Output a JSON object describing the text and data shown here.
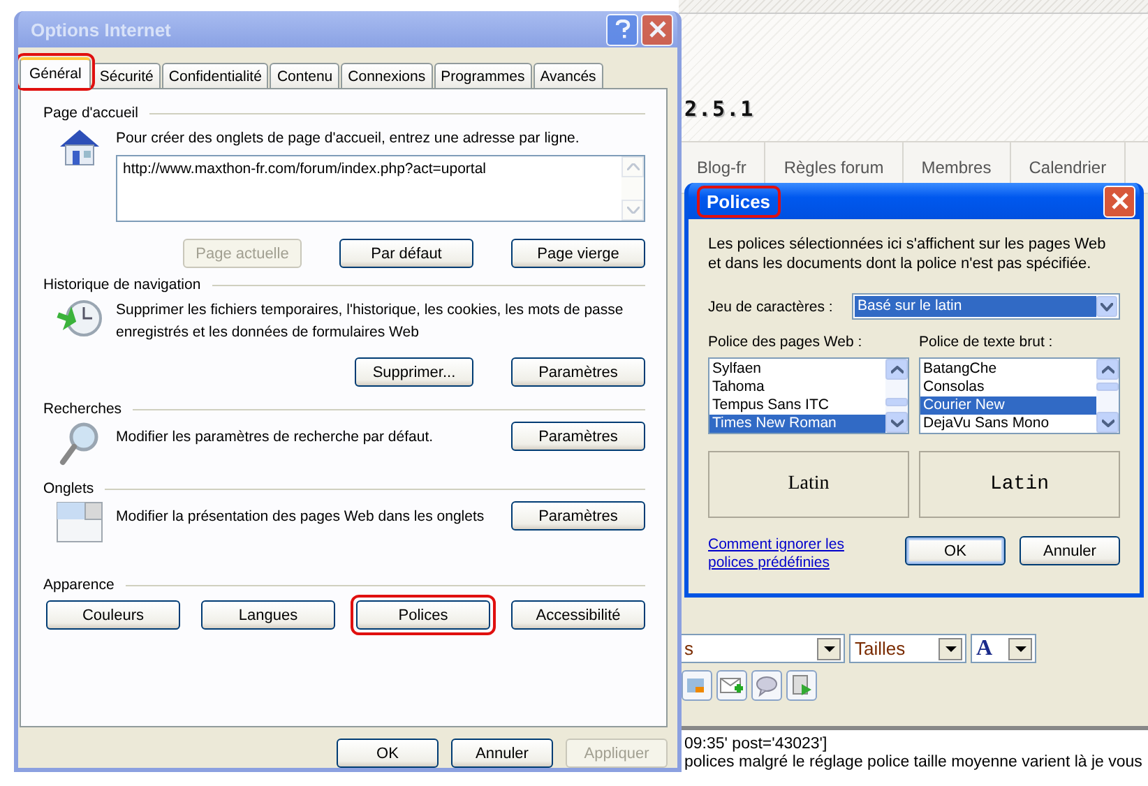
{
  "background_page": {
    "logo_text": "2.5.1",
    "nav": [
      "Blog-fr",
      "Règles forum",
      "Membres",
      "Calendrier"
    ],
    "toolbar": {
      "font_select": "s",
      "size_select": "Tailles",
      "color_button": "A"
    },
    "post_lines": [
      "09:35' post='43023']",
      "polices malgré le réglage police taille moyenne varient là je vous"
    ]
  },
  "options_dialog": {
    "title": "Options Internet",
    "active": false,
    "tabs": [
      {
        "label": "Général",
        "selected": true,
        "highlighted": true
      },
      {
        "label": "Sécurité",
        "selected": false,
        "highlighted": false
      },
      {
        "label": "Confidentialité",
        "selected": false,
        "highlighted": false
      },
      {
        "label": "Contenu",
        "selected": false,
        "highlighted": false
      },
      {
        "label": "Connexions",
        "selected": false,
        "highlighted": false
      },
      {
        "label": "Programmes",
        "selected": false,
        "highlighted": false
      },
      {
        "label": "Avancés",
        "selected": false,
        "highlighted": false
      }
    ],
    "sections": [
      {
        "kind": "homepage",
        "heading": "Page d'accueil",
        "description": "Pour créer des onglets de page d'accueil, entrez une adresse par ligne.",
        "address": "http://www.maxthon-fr.com/forum/index.php?act=uportal",
        "buttons": [
          {
            "label": "Page actuelle",
            "disabled": true,
            "highlighted": false
          },
          {
            "label": "Par défaut",
            "disabled": false,
            "highlighted": false
          },
          {
            "label": "Page vierge",
            "disabled": false,
            "highlighted": false
          }
        ]
      },
      {
        "kind": "history",
        "heading": "Historique de navigation",
        "description": "Supprimer les fichiers temporaires, l'historique, les cookies, les mots de passe enregistrés et les données de formulaires Web",
        "buttons": [
          {
            "label": "Supprimer...",
            "disabled": false,
            "highlighted": false
          },
          {
            "label": "Paramètres",
            "disabled": false,
            "highlighted": false
          }
        ]
      },
      {
        "kind": "search",
        "heading": "Recherches",
        "description": "Modifier les paramètres de recherche par défaut.",
        "buttons": [
          {
            "label": "Paramètres",
            "disabled": false,
            "highlighted": false
          }
        ]
      },
      {
        "kind": "tabs",
        "heading": "Onglets",
        "description": "Modifier la présentation des pages Web dans les onglets",
        "buttons": [
          {
            "label": "Paramètres",
            "disabled": false,
            "highlighted": false
          }
        ]
      },
      {
        "kind": "appearance",
        "heading": "Apparence",
        "buttons": [
          {
            "label": "Couleurs",
            "disabled": false,
            "highlighted": false
          },
          {
            "label": "Langues",
            "disabled": false,
            "highlighted": false
          },
          {
            "label": "Polices",
            "disabled": false,
            "highlighted": true
          },
          {
            "label": "Accessibilité",
            "disabled": false,
            "highlighted": false
          }
        ]
      }
    ],
    "footer_buttons": [
      {
        "label": "OK",
        "disabled": false
      },
      {
        "label": "Annuler",
        "disabled": false
      },
      {
        "label": "Appliquer",
        "disabled": true
      }
    ]
  },
  "fonts_dialog": {
    "title": "Polices",
    "active": true,
    "title_highlighted": true,
    "description": "Les polices sélectionnées ici s'affichent sur les pages Web et dans les documents dont la police n'est pas spécifiée.",
    "charset_label": "Jeu de caractères :",
    "charset_value": "Basé sur le latin",
    "lists": [
      {
        "label": "Police des pages Web :",
        "preview": "Latin",
        "kind": "proportional",
        "items": [
          {
            "name": "Sylfaen",
            "selected": false
          },
          {
            "name": "Tahoma",
            "selected": false
          },
          {
            "name": "Tempus Sans ITC",
            "selected": false
          },
          {
            "name": "Times New Roman",
            "selected": true
          }
        ]
      },
      {
        "label": "Police de texte brut :",
        "preview": "Latin",
        "kind": "monospace",
        "items": [
          {
            "name": "BatangChe",
            "selected": false
          },
          {
            "name": "Consolas",
            "selected": false
          },
          {
            "name": "Courier New",
            "selected": true
          },
          {
            "name": "DejaVu Sans Mono",
            "selected": false
          }
        ]
      }
    ],
    "help_link": "Comment ignorer les polices prédéfinies",
    "buttons": [
      {
        "label": "OK",
        "default": true
      },
      {
        "label": "Annuler",
        "default": false
      }
    ]
  }
}
